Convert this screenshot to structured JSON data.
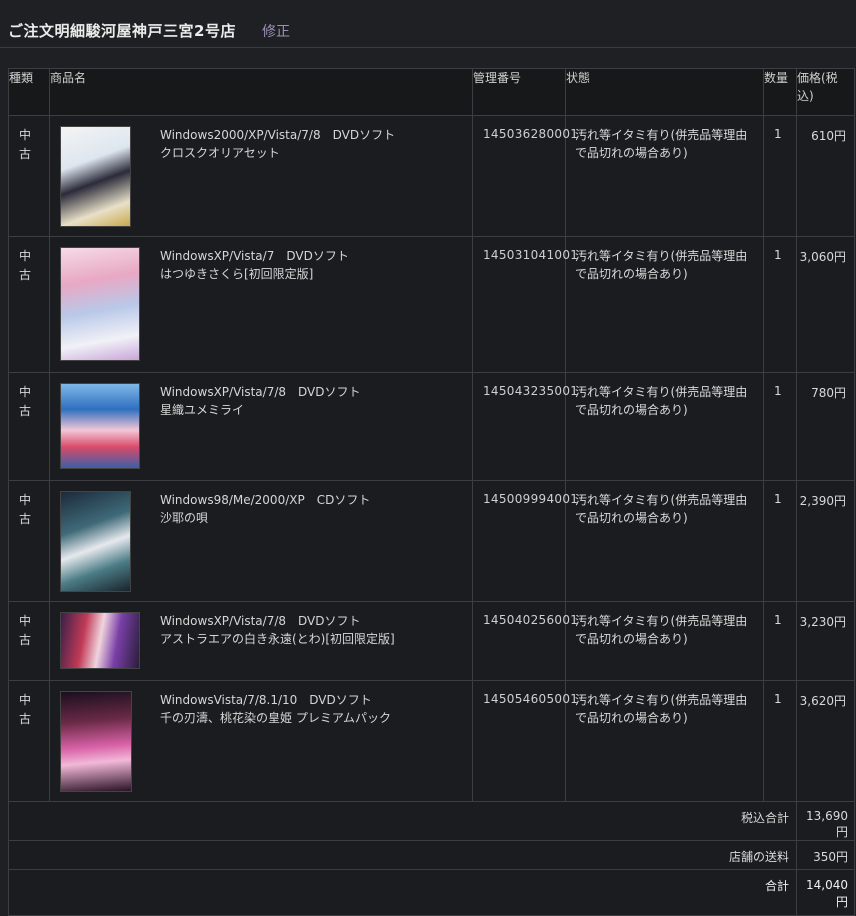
{
  "header": {
    "store_title": "ご注文明細駿河屋神戸三宮2号店",
    "edit_label": "修正"
  },
  "table": {
    "headers": {
      "type": "種類",
      "product": "商品名",
      "mgmt": "管理番号",
      "status": "状態",
      "qty": "数量",
      "price": "価格(税込)"
    },
    "rows": [
      {
        "type": "中古",
        "platform": "Windows2000/XP/Vista/7/8　DVDソフト",
        "title": "クロスクオリアセット",
        "mgmt": "145036280001",
        "status": "汚れ等イタミ有り(併売品等理由で品切れの場合あり)",
        "qty": "1",
        "price": "610円"
      },
      {
        "type": "中古",
        "platform": "WindowsXP/Vista/7　DVDソフト",
        "title": "はつゆきさくら[初回限定版]",
        "mgmt": "145031041001",
        "status": "汚れ等イタミ有り(併売品等理由で品切れの場合あり)",
        "qty": "1",
        "price": "3,060円"
      },
      {
        "type": "中古",
        "platform": "WindowsXP/Vista/7/8　DVDソフト",
        "title": "星織ユメミライ",
        "mgmt": "145043235001",
        "status": "汚れ等イタミ有り(併売品等理由で品切れの場合あり)",
        "qty": "1",
        "price": "780円"
      },
      {
        "type": "中古",
        "platform": "Windows98/Me/2000/XP　CDソフト",
        "title": "沙耶の唄",
        "mgmt": "145009994001",
        "status": "汚れ等イタミ有り(併売品等理由で品切れの場合あり)",
        "qty": "1",
        "price": "2,390円"
      },
      {
        "type": "中古",
        "platform": "WindowsXP/Vista/7/8　DVDソフト",
        "title": "アストラエアの白き永遠(とわ)[初回限定版]",
        "mgmt": "145040256001",
        "status": "汚れ等イタミ有り(併売品等理由で品切れの場合あり)",
        "qty": "1",
        "price": "3,230円"
      },
      {
        "type": "中古",
        "platform": "WindowsVista/7/8.1/10　DVDソフト",
        "title": "千の刃濤、桃花染の皇姫 プレミアムパック",
        "mgmt": "145054605001",
        "status": "汚れ等イタミ有り(併売品等理由で品切れの場合あり)",
        "qty": "1",
        "price": "3,620円"
      }
    ]
  },
  "summary": {
    "subtotal_label": "税込合計",
    "subtotal_value": "13,690円",
    "shipping_label": "店舗の送料",
    "shipping_value": "350円",
    "total_label": "合計",
    "total_value": "14,040円"
  }
}
